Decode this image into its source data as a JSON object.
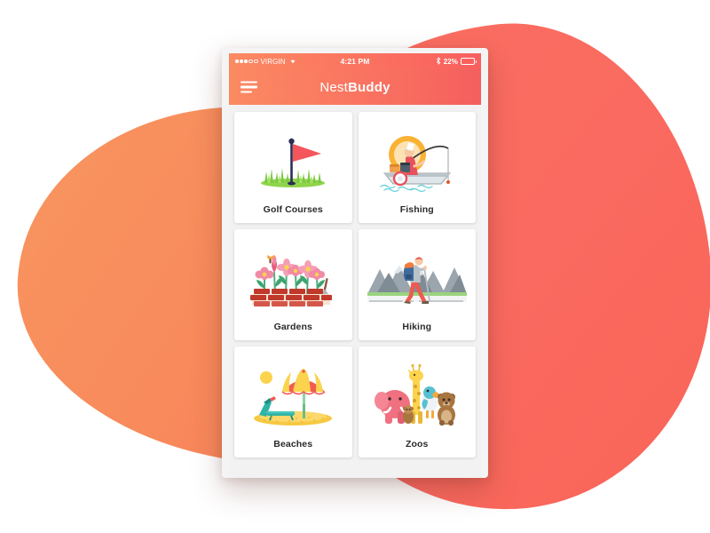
{
  "background": {
    "blob_left_color": "#F8905E",
    "blob_right_color": "#FB6F62",
    "page_color": "#FFFFFF"
  },
  "phone": {
    "frame_color": "#F4F4F4",
    "screen_bg": "#F2F2F2"
  },
  "status_bar": {
    "carrier": "VIRGIN",
    "signal_dots_filled": 3,
    "signal_dots_total": 5,
    "wifi_icon": "wifi-icon",
    "time": "4:21 PM",
    "bluetooth_icon": "bluetooth-icon",
    "battery_percent": "22%",
    "battery_level": 22,
    "battery_icon": "battery-icon"
  },
  "nav_bar": {
    "menu_icon": "hamburger-menu-icon",
    "title_light": "Nest",
    "title_bold": "Buddy",
    "gradient_from": "#FB8A62",
    "gradient_to": "#F45F5E"
  },
  "grid": {
    "cards": [
      {
        "id": "golf-courses",
        "label": "Golf Courses",
        "icon": "golf-flag-icon"
      },
      {
        "id": "fishing",
        "label": "Fishing",
        "icon": "fishing-boat-icon"
      },
      {
        "id": "gardens",
        "label": "Gardens",
        "icon": "flower-garden-icon"
      },
      {
        "id": "hiking",
        "label": "Hiking",
        "icon": "hiker-mountains-icon"
      },
      {
        "id": "beaches",
        "label": "Beaches",
        "icon": "beach-umbrella-icon"
      },
      {
        "id": "zoos",
        "label": "Zoos",
        "icon": "zoo-animals-icon"
      }
    ]
  }
}
